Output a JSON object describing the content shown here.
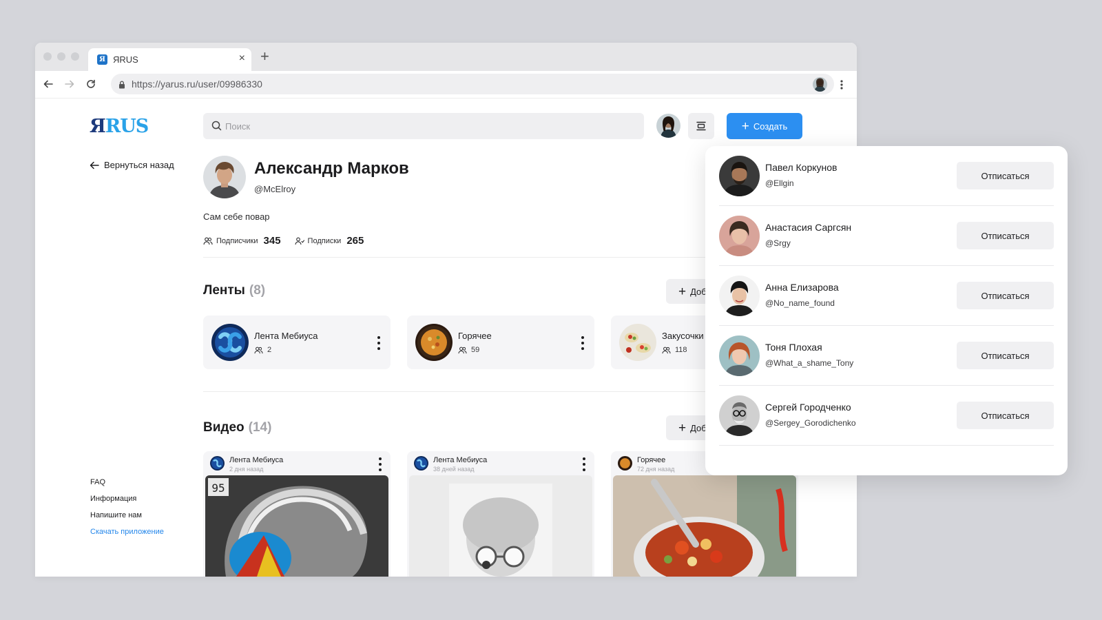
{
  "browser": {
    "tab_title": "ЯRUS",
    "favicon_letter": "Я",
    "url": "https://yarus.ru/user/09986330"
  },
  "app": {
    "logo_ya": "Я",
    "logo_rus": "RUS",
    "back_label": "Вернуться назад",
    "search_placeholder": "Поиск",
    "create_label": "Создать",
    "accent_color": "#2c8ff1"
  },
  "profile": {
    "name": "Александр Марков",
    "handle": "@McElroy",
    "bio": "Сам себе повар",
    "followers_label": "Подписчики",
    "followers_count": "345",
    "following_label": "Подписки",
    "following_count": "265"
  },
  "feeds": {
    "title": "Ленты",
    "count": "(8)",
    "add_label": "Добавить",
    "items": [
      {
        "name": "Лента Мебиуса",
        "count": "2"
      },
      {
        "name": "Горячее",
        "count": "59"
      },
      {
        "name": "Закусочки",
        "count": "118"
      }
    ]
  },
  "videos": {
    "title": "Видео",
    "count": "(14)",
    "add_label": "Добавить",
    "items": [
      {
        "feed": "Лента Мебиуса",
        "time": "2 дня назад",
        "badge": "95"
      },
      {
        "feed": "Лента Мебиуса",
        "time": "38 дней назад"
      },
      {
        "feed": "Горячее",
        "time": "72 дня назад"
      }
    ]
  },
  "footer": {
    "faq": "FAQ",
    "info": "Информация",
    "contact": "Напишите нам",
    "download": "Скачать приложение"
  },
  "subscriptions": {
    "unsubscribe_label": "Отписаться",
    "items": [
      {
        "name": "Павел Коркунов",
        "handle": "@Ellgin"
      },
      {
        "name": "Анастасия Саргсян",
        "handle": "@Srgy"
      },
      {
        "name": "Анна Елизарова",
        "handle": "@No_name_found"
      },
      {
        "name": "Тоня Плохая",
        "handle": "@What_a_shame_Tony"
      },
      {
        "name": "Сергей Городченко",
        "handle": "@Sergey_Gorodichenko"
      }
    ]
  }
}
